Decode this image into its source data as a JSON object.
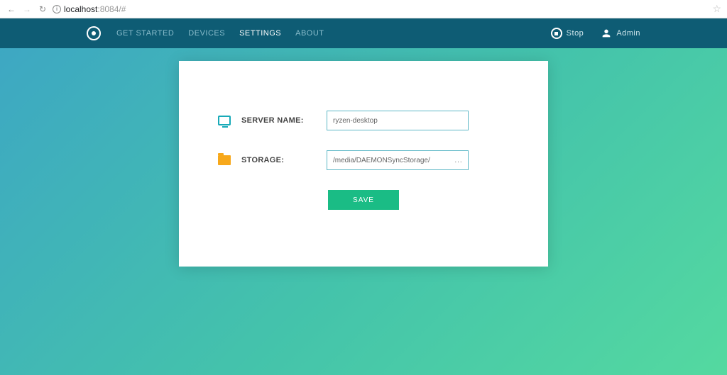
{
  "browser": {
    "url_host": "localhost",
    "url_port": ":8084/#"
  },
  "header": {
    "nav": {
      "get_started": "GET STARTED",
      "devices": "DEVICES",
      "settings": "SETTINGS",
      "about": "ABOUT"
    },
    "stop": "Stop",
    "admin": "Admin"
  },
  "form": {
    "server_label": "SERVER NAME:",
    "server_value": "ryzen-desktop",
    "storage_label": "STORAGE:",
    "storage_value": "/media/DAEMONSyncStorage/",
    "browse": "...",
    "save": "SAVE"
  }
}
